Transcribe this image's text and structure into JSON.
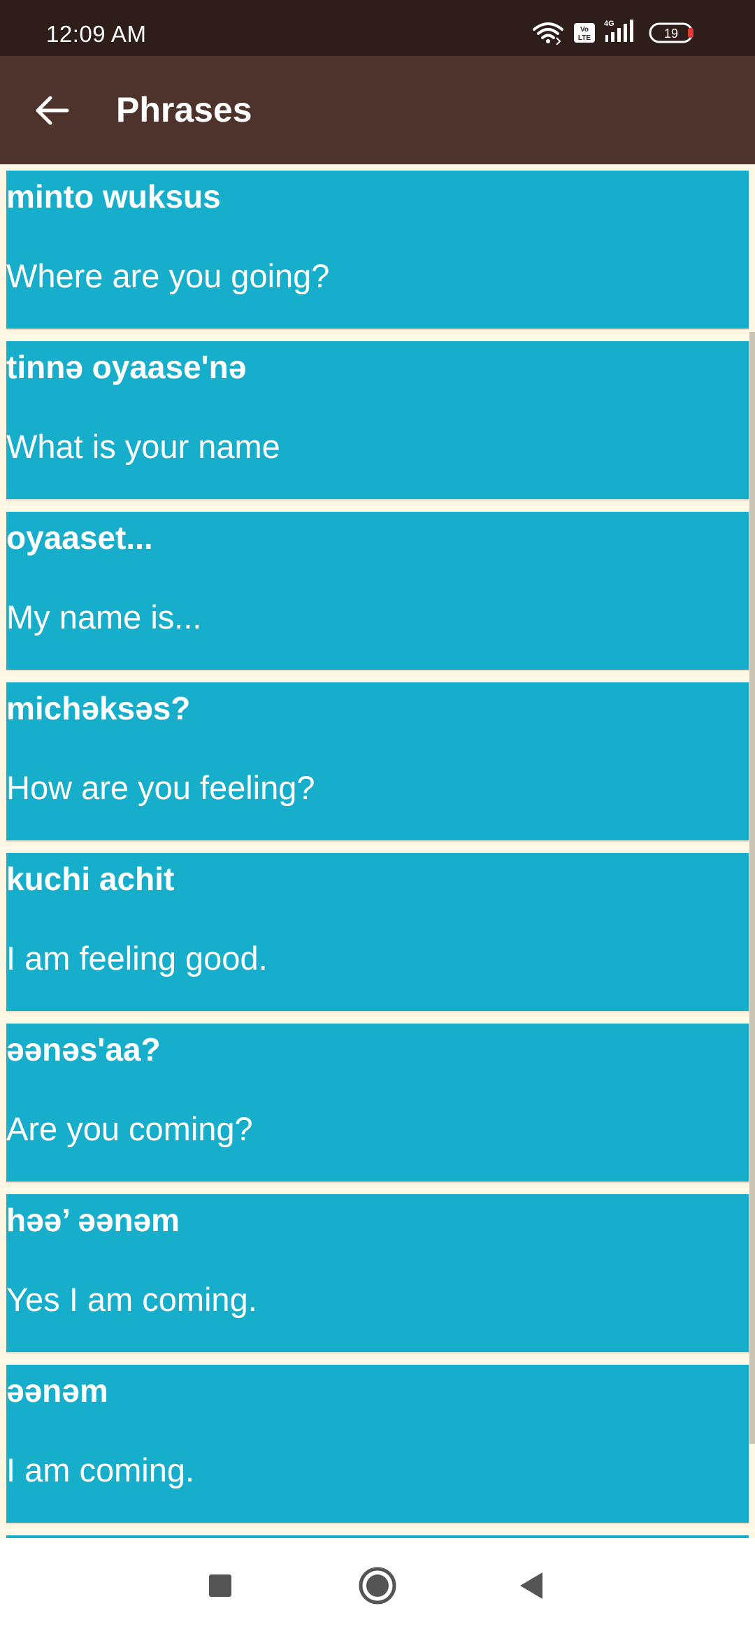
{
  "status_bar": {
    "time": "12:09 AM",
    "battery": "19",
    "network": "4G",
    "volte": "Vo LTE",
    "icons": [
      "wifi-icon",
      "volte-icon",
      "signal-icon",
      "battery-icon"
    ]
  },
  "app_bar": {
    "title": "Phrases",
    "back_icon": "arrow-left-icon"
  },
  "phrases": [
    {
      "phrase": "minto wuksus",
      "translation": "Where are you going?"
    },
    {
      "phrase": "tinnə oyaase'nə",
      "translation": "What is your name"
    },
    {
      "phrase": "oyaaset...",
      "translation": "My name is..."
    },
    {
      "phrase": "michəksəs?",
      "translation": "How are you feeling?"
    },
    {
      "phrase": "kuchi achit",
      "translation": "I am feeling good."
    },
    {
      "phrase": "əənəs'aa?",
      "translation": "Are you coming?"
    },
    {
      "phrase": "həə’ əənəm",
      "translation": "Yes I am coming."
    },
    {
      "phrase": "əənəm",
      "translation": "I am coming."
    }
  ],
  "colors": {
    "status_bar": "#2f1d1a",
    "app_bar": "#4e322c",
    "card": "#16aecb",
    "background": "#fdf6e3"
  },
  "nav_bar": {
    "icons": [
      "recent-apps-icon",
      "home-icon",
      "back-icon"
    ]
  }
}
